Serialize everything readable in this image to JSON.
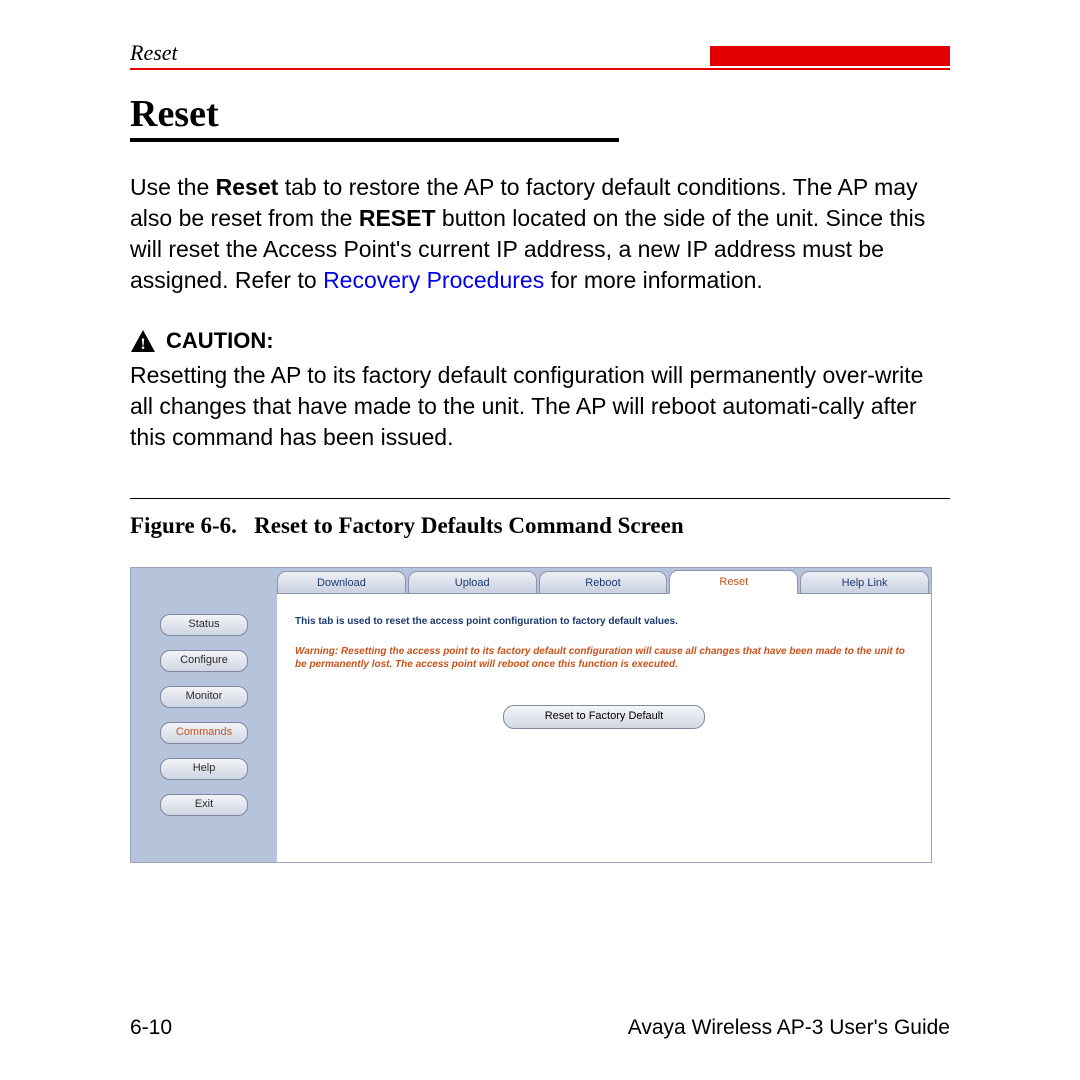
{
  "header": {
    "section": "Reset"
  },
  "heading": "Reset",
  "paragraph": {
    "p1a": "Use the ",
    "p1b": "Reset",
    "p1c": " tab to restore the AP to factory default conditions. The AP may also be reset from the ",
    "p1d": "RESET",
    "p1e": " button located on the side of the unit. Since this will reset the Access Point's current IP address, a new IP address must be assigned. Refer to ",
    "link": "Recovery Procedures",
    "p1f": " for more information."
  },
  "caution": {
    "label": "CAUTION:",
    "body": "Resetting the AP to its factory default configuration will permanently over-write all changes that have made to the unit. The AP will reboot automati-cally after this command has been issued."
  },
  "figure": {
    "caption_prefix": "Figure 6-6.",
    "caption_title": "Reset to Factory Defaults Command Screen"
  },
  "screenshot": {
    "sidebar": [
      "Status",
      "Configure",
      "Monitor",
      "Commands",
      "Help",
      "Exit"
    ],
    "sidebar_active_index": 3,
    "tabs": [
      "Download",
      "Upload",
      "Reboot",
      "Reset",
      "Help Link"
    ],
    "active_tab_index": 3,
    "info_text": "This tab is used to reset the access point configuration to factory default values.",
    "warning_text": "Warning: Resetting the access point to its factory default configuration will cause all changes that have been made to the unit to be permanently lost. The access point will reboot once this function is executed.",
    "reset_button": "Reset to Factory Default"
  },
  "footer": {
    "page": "6-10",
    "doc": "Avaya Wireless AP-3 User's Guide"
  }
}
